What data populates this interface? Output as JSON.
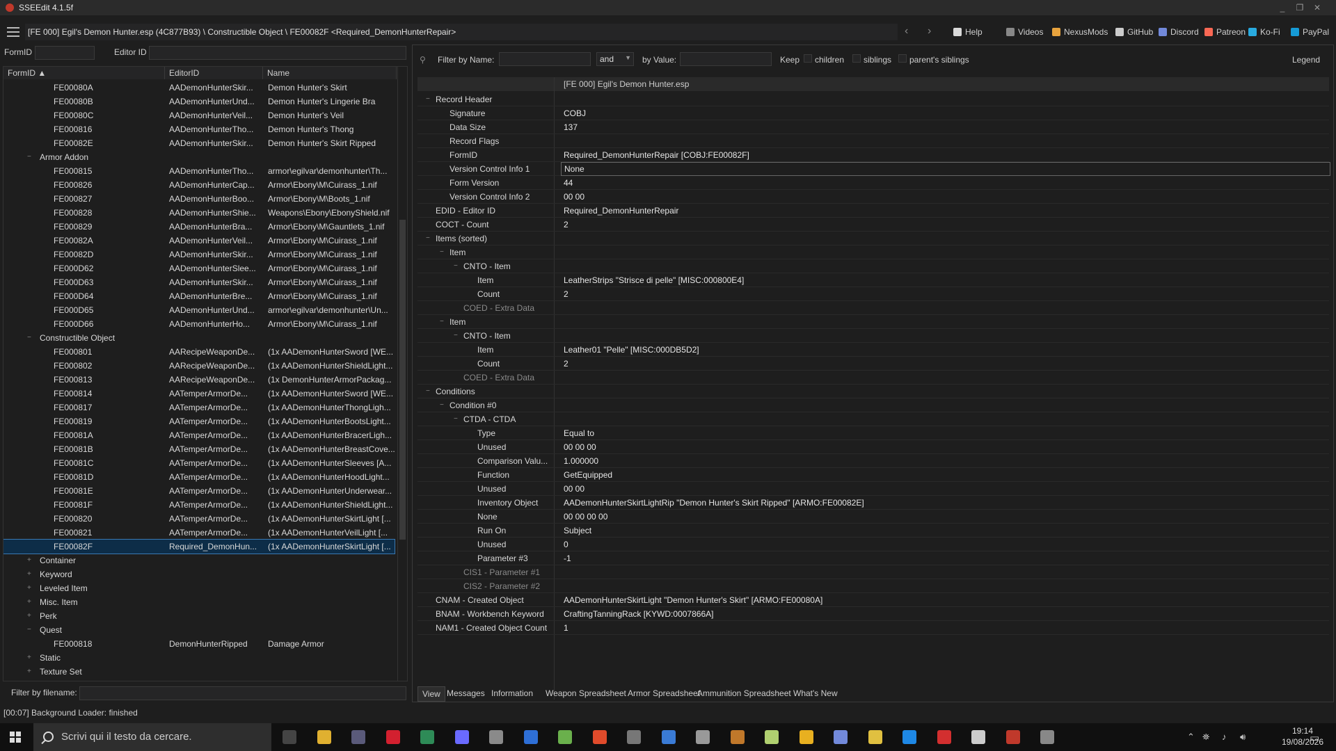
{
  "window": {
    "title": "SSEEdit 4.1.5f",
    "min": "_",
    "max": "❐",
    "close": "✕"
  },
  "toolbar": {
    "path": "[FE 000] Egil's Demon Hunter.esp (4C877B93) \\ Constructible Object \\ FE00082F <Required_DemonHunterRepair>",
    "back": "‹",
    "forward": "›",
    "links": [
      {
        "label": "Help",
        "icon": "book-icon",
        "color": "#d9d9d9"
      },
      {
        "label": "Videos",
        "icon": "video-icon",
        "color": "#888888"
      },
      {
        "label": "NexusMods",
        "icon": "nexus-icon",
        "color": "#e8a33d"
      },
      {
        "label": "GitHub",
        "icon": "github-icon",
        "color": "#cccccc"
      },
      {
        "label": "Discord",
        "icon": "discord-icon",
        "color": "#7289da"
      },
      {
        "label": "Patreon",
        "icon": "patreon-icon",
        "color": "#f96854"
      },
      {
        "label": "Ko-Fi",
        "icon": "kofi-icon",
        "color": "#29abe0"
      },
      {
        "label": "PayPal",
        "icon": "paypal-icon",
        "color": "#169bd7"
      }
    ]
  },
  "left_filter": {
    "formid_label": "FormID",
    "editorid_label": "Editor ID"
  },
  "left_tree": {
    "columns": [
      "FormID ▲",
      "EditorID",
      "Name"
    ],
    "rows": [
      {
        "depth": 2,
        "id": "FE00080A",
        "editor": "AADemonHunterSkir...",
        "name": "Demon Hunter's Skirt"
      },
      {
        "depth": 2,
        "id": "FE00080B",
        "editor": "AADemonHunterUnd...",
        "name": "Demon Hunter's Lingerie Bra"
      },
      {
        "depth": 2,
        "id": "FE00080C",
        "editor": "AADemonHunterVeil...",
        "name": "Demon Hunter's Veil"
      },
      {
        "depth": 2,
        "id": "FE000816",
        "editor": "AADemonHunterTho...",
        "name": "Demon Hunter's Thong"
      },
      {
        "depth": 2,
        "id": "FE00082E",
        "editor": "AADemonHunterSkir...",
        "name": "Demon Hunter's Skirt Ripped"
      },
      {
        "depth": 1,
        "id": "Armor Addon",
        "editor": "",
        "name": "",
        "exp": "−"
      },
      {
        "depth": 2,
        "id": "FE000815",
        "editor": "AADemonHunterTho...",
        "name": "armor\\egilvar\\demonhunter\\Th..."
      },
      {
        "depth": 2,
        "id": "FE000826",
        "editor": "AADemonHunterCap...",
        "name": "Armor\\Ebony\\M\\Cuirass_1.nif"
      },
      {
        "depth": 2,
        "id": "FE000827",
        "editor": "AADemonHunterBoo...",
        "name": "Armor\\Ebony\\M\\Boots_1.nif"
      },
      {
        "depth": 2,
        "id": "FE000828",
        "editor": "AADemonHunterShie...",
        "name": "Weapons\\Ebony\\EbonyShield.nif"
      },
      {
        "depth": 2,
        "id": "FE000829",
        "editor": "AADemonHunterBra...",
        "name": "Armor\\Ebony\\M\\Gauntlets_1.nif"
      },
      {
        "depth": 2,
        "id": "FE00082A",
        "editor": "AADemonHunterVeil...",
        "name": "Armor\\Ebony\\M\\Cuirass_1.nif"
      },
      {
        "depth": 2,
        "id": "FE00082D",
        "editor": "AADemonHunterSkir...",
        "name": "Armor\\Ebony\\M\\Cuirass_1.nif"
      },
      {
        "depth": 2,
        "id": "FE000D62",
        "editor": "AADemonHunterSlee...",
        "name": "Armor\\Ebony\\M\\Cuirass_1.nif"
      },
      {
        "depth": 2,
        "id": "FE000D63",
        "editor": "AADemonHunterSkir...",
        "name": "Armor\\Ebony\\M\\Cuirass_1.nif"
      },
      {
        "depth": 2,
        "id": "FE000D64",
        "editor": "AADemonHunterBre...",
        "name": "Armor\\Ebony\\M\\Cuirass_1.nif"
      },
      {
        "depth": 2,
        "id": "FE000D65",
        "editor": "AADemonHunterUnd...",
        "name": "armor\\egilvar\\demonhunter\\Un..."
      },
      {
        "depth": 2,
        "id": "FE000D66",
        "editor": "AADemonHunterHo...",
        "name": "Armor\\Ebony\\M\\Cuirass_1.nif"
      },
      {
        "depth": 1,
        "id": "Constructible Object",
        "editor": "",
        "name": "",
        "exp": "−"
      },
      {
        "depth": 2,
        "id": "FE000801",
        "editor": "AARecipeWeaponDe...",
        "name": "(1x AADemonHunterSword [WE..."
      },
      {
        "depth": 2,
        "id": "FE000802",
        "editor": "AARecipeWeaponDe...",
        "name": "(1x AADemonHunterShieldLight..."
      },
      {
        "depth": 2,
        "id": "FE000813",
        "editor": "AARecipeWeaponDe...",
        "name": "(1x DemonHunterArmorPackag..."
      },
      {
        "depth": 2,
        "id": "FE000814",
        "editor": "AATemperArmorDe...",
        "name": "(1x AADemonHunterSword [WE..."
      },
      {
        "depth": 2,
        "id": "FE000817",
        "editor": "AATemperArmorDe...",
        "name": "(1x AADemonHunterThongLigh..."
      },
      {
        "depth": 2,
        "id": "FE000819",
        "editor": "AATemperArmorDe...",
        "name": "(1x AADemonHunterBootsLight..."
      },
      {
        "depth": 2,
        "id": "FE00081A",
        "editor": "AATemperArmorDe...",
        "name": "(1x AADemonHunterBracerLigh..."
      },
      {
        "depth": 2,
        "id": "FE00081B",
        "editor": "AATemperArmorDe...",
        "name": "(1x AADemonHunterBreastCove..."
      },
      {
        "depth": 2,
        "id": "FE00081C",
        "editor": "AATemperArmorDe...",
        "name": "(1x AADemonHunterSleeves [A..."
      },
      {
        "depth": 2,
        "id": "FE00081D",
        "editor": "AATemperArmorDe...",
        "name": "(1x AADemonHunterHoodLight..."
      },
      {
        "depth": 2,
        "id": "FE00081E",
        "editor": "AATemperArmorDe...",
        "name": "(1x AADemonHunterUnderwear..."
      },
      {
        "depth": 2,
        "id": "FE00081F",
        "editor": "AATemperArmorDe...",
        "name": "(1x AADemonHunterShieldLight..."
      },
      {
        "depth": 2,
        "id": "FE000820",
        "editor": "AATemperArmorDe...",
        "name": "(1x AADemonHunterSkirtLight [..."
      },
      {
        "depth": 2,
        "id": "FE000821",
        "editor": "AATemperArmorDe...",
        "name": "(1x AADemonHunterVeilLight [..."
      },
      {
        "depth": 2,
        "id": "FE00082F",
        "editor": "Required_DemonHun...",
        "name": "(1x AADemonHunterSkirtLight [...",
        "sel": true
      },
      {
        "depth": 1,
        "id": "Container",
        "editor": "",
        "name": "",
        "exp": "+"
      },
      {
        "depth": 1,
        "id": "Keyword",
        "editor": "",
        "name": "",
        "exp": "+"
      },
      {
        "depth": 1,
        "id": "Leveled Item",
        "editor": "",
        "name": "",
        "exp": "+"
      },
      {
        "depth": 1,
        "id": "Misc. Item",
        "editor": "",
        "name": "",
        "exp": "+"
      },
      {
        "depth": 1,
        "id": "Perk",
        "editor": "",
        "name": "",
        "exp": "+"
      },
      {
        "depth": 1,
        "id": "Quest",
        "editor": "",
        "name": "",
        "exp": "−"
      },
      {
        "depth": 2,
        "id": "FE000818",
        "editor": "DemonHunterRipped",
        "name": "Damage Armor"
      },
      {
        "depth": 1,
        "id": "Static",
        "editor": "",
        "name": "",
        "exp": "+"
      },
      {
        "depth": 1,
        "id": "Texture Set",
        "editor": "",
        "name": "",
        "exp": "+"
      }
    ],
    "filename_label": "Filter by filename:"
  },
  "right_filter": {
    "by_name": "Filter by Name:",
    "and": "and",
    "by_value": "by Value:",
    "keep": "Keep",
    "children": "children",
    "siblings": "siblings",
    "parents": "parent's siblings",
    "legend": "Legend"
  },
  "record": {
    "file_header": "[FE 000] Egil's Demon Hunter.esp",
    "rows": [
      {
        "d": 0,
        "label": "Record Header",
        "value": "",
        "exp": "−"
      },
      {
        "d": 1,
        "label": "Signature",
        "value": "COBJ"
      },
      {
        "d": 1,
        "label": "Data Size",
        "value": "137"
      },
      {
        "d": 1,
        "label": "Record Flags",
        "value": ""
      },
      {
        "d": 1,
        "label": "FormID",
        "value": "Required_DemonHunterRepair [COBJ:FE00082F]"
      },
      {
        "d": 1,
        "label": "Version Control Info 1",
        "value": "None",
        "boxed": true
      },
      {
        "d": 1,
        "label": "Form Version",
        "value": "44"
      },
      {
        "d": 1,
        "label": "Version Control Info 2",
        "value": "00 00"
      },
      {
        "d": 0,
        "label": "EDID - Editor ID",
        "value": "Required_DemonHunterRepair"
      },
      {
        "d": 0,
        "label": "COCT - Count",
        "value": "2"
      },
      {
        "d": 0,
        "label": "Items (sorted)",
        "value": "",
        "exp": "−"
      },
      {
        "d": 1,
        "label": "Item",
        "value": "",
        "exp": "−"
      },
      {
        "d": 2,
        "label": "CNTO - Item",
        "value": "",
        "exp": "−"
      },
      {
        "d": 3,
        "label": "Item",
        "value": "LeatherStrips \"Strisce di pelle\" [MISC:000800E4]"
      },
      {
        "d": 3,
        "label": "Count",
        "value": "2"
      },
      {
        "d": 2,
        "label": "COED - Extra Data",
        "value": "",
        "dim": true
      },
      {
        "d": 1,
        "label": "Item",
        "value": "",
        "exp": "−"
      },
      {
        "d": 2,
        "label": "CNTO - Item",
        "value": "",
        "exp": "−"
      },
      {
        "d": 3,
        "label": "Item",
        "value": "Leather01 \"Pelle\" [MISC:000DB5D2]"
      },
      {
        "d": 3,
        "label": "Count",
        "value": "2"
      },
      {
        "d": 2,
        "label": "COED - Extra Data",
        "value": "",
        "dim": true
      },
      {
        "d": 0,
        "label": "Conditions",
        "value": "",
        "exp": "−"
      },
      {
        "d": 1,
        "label": "Condition #0",
        "value": "",
        "exp": "−"
      },
      {
        "d": 2,
        "label": "CTDA - CTDA",
        "value": "",
        "exp": "−"
      },
      {
        "d": 3,
        "label": "Type",
        "value": "Equal to"
      },
      {
        "d": 3,
        "label": "Unused",
        "value": "00 00 00"
      },
      {
        "d": 3,
        "label": "Comparison Valu...",
        "value": "1.000000"
      },
      {
        "d": 3,
        "label": "Function",
        "value": "GetEquipped"
      },
      {
        "d": 3,
        "label": "Unused",
        "value": "00 00"
      },
      {
        "d": 3,
        "label": "Inventory Object",
        "value": "AADemonHunterSkirtLightRip \"Demon Hunter's Skirt Ripped\" [ARMO:FE00082E]"
      },
      {
        "d": 3,
        "label": "None",
        "value": "00 00 00 00"
      },
      {
        "d": 3,
        "label": "Run On",
        "value": "Subject"
      },
      {
        "d": 3,
        "label": "Unused",
        "value": "0"
      },
      {
        "d": 3,
        "label": "Parameter #3",
        "value": "-1"
      },
      {
        "d": 2,
        "label": "CIS1 - Parameter #1",
        "value": "",
        "dim": true
      },
      {
        "d": 2,
        "label": "CIS2 - Parameter #2",
        "value": "",
        "dim": true
      },
      {
        "d": 0,
        "label": "CNAM - Created Object",
        "value": "AADemonHunterSkirtLight \"Demon Hunter's Skirt\" [ARMO:FE00080A]"
      },
      {
        "d": 0,
        "label": "BNAM - Workbench Keyword",
        "value": "CraftingTanningRack [KYWD:0007866A]"
      },
      {
        "d": 0,
        "label": "NAM1 - Created Object Count",
        "value": "1"
      }
    ]
  },
  "bottom_tabs": [
    "View",
    "Messages",
    "Information",
    "Weapon Spreadsheet",
    "Armor Spreadsheet",
    "Ammunition Spreadsheet",
    "What's New"
  ],
  "status": "[00:07] Background Loader: finished",
  "taskbar": {
    "search_placeholder": "Scrivi qui il testo da cercare.",
    "time": "19:14",
    "date": "19/08/2026",
    "apps": [
      {
        "icon": "task-view-icon",
        "color": "#444444"
      },
      {
        "icon": "file-explorer-icon",
        "color": "#e0b030"
      },
      {
        "icon": "app-icon",
        "color": "#5a5a7a"
      },
      {
        "icon": "opera-icon",
        "color": "#d3202f"
      },
      {
        "icon": "terminal-icon",
        "color": "#2e8b57"
      },
      {
        "icon": "tool-icon",
        "color": "#6a6aff"
      },
      {
        "icon": "app-icon",
        "color": "#8a8a8a"
      },
      {
        "icon": "window-icon",
        "color": "#2e6fd6"
      },
      {
        "icon": "notepad-icon",
        "color": "#6ab04c"
      },
      {
        "icon": "f-app-icon",
        "color": "#e04b2b"
      },
      {
        "icon": "arrow-app-icon",
        "color": "#777777"
      },
      {
        "icon": "window-icon",
        "color": "#3a7bd5"
      },
      {
        "icon": "calendar-icon",
        "color": "#999999"
      },
      {
        "icon": "app-icon",
        "color": "#c0782a"
      },
      {
        "icon": "app-icon",
        "color": "#b0d070"
      },
      {
        "icon": "chrome-icon",
        "color": "#e8b020"
      },
      {
        "icon": "discord-icon",
        "color": "#7289da"
      },
      {
        "icon": "folder-icon",
        "color": "#e0c040"
      },
      {
        "icon": "app-icon",
        "color": "#1e88e5"
      },
      {
        "icon": "app-icon",
        "color": "#d32f2f"
      },
      {
        "icon": "app-icon",
        "color": "#cccccc"
      },
      {
        "icon": "sseedit-icon",
        "color": "#c0392b"
      },
      {
        "icon": "app-icon",
        "color": "#888888"
      }
    ]
  }
}
